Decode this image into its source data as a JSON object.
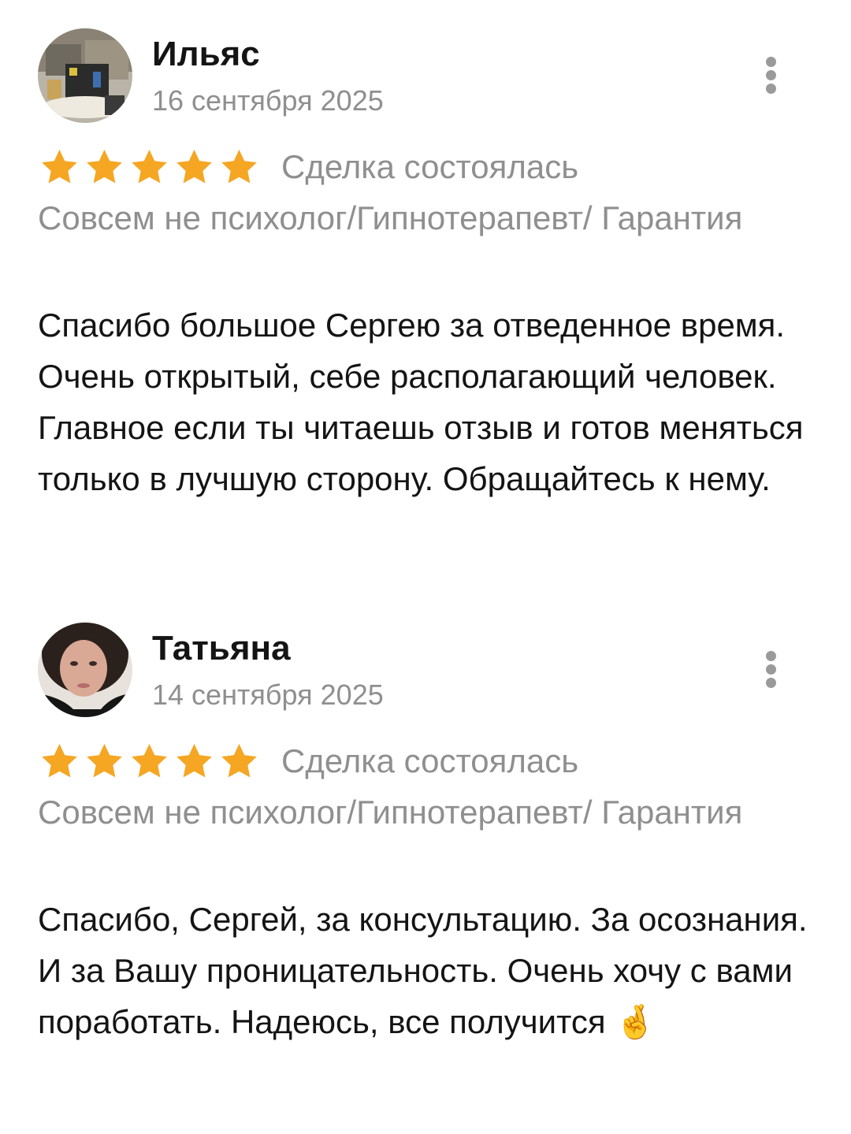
{
  "colors": {
    "star": "#f5a623",
    "muted_text": "#8f8f8f",
    "primary_text": "#141414"
  },
  "reviews": [
    {
      "author": "Ильяс",
      "date": "16 сентября 2025",
      "rating": 5,
      "deal_status": "Сделка состоялась",
      "service": "Совсем не психолог/Гипнотерапевт/ Гарантия",
      "text": "Спасибо большое Сергею за отведенное время. Очень открытый, себе располагающий человек. Главное если ты читаешь отзыв и готов меняться только в лучшую сторону. Обращайтесь к нему.",
      "icons": {
        "more": "more-vertical-icon",
        "star": "star-icon"
      }
    },
    {
      "author": "Татьяна",
      "date": "14 сентября 2025",
      "rating": 5,
      "deal_status": "Сделка состоялась",
      "service": "Совсем не психолог/Гипнотерапевт/ Гарантия",
      "text": "Спасибо, Сергей, за консультацию. За осознания. И за Вашу проницательность. Очень хочу с вами поработать. Надеюсь, все получится 🤞",
      "icons": {
        "more": "more-vertical-icon",
        "star": "star-icon"
      }
    }
  ]
}
